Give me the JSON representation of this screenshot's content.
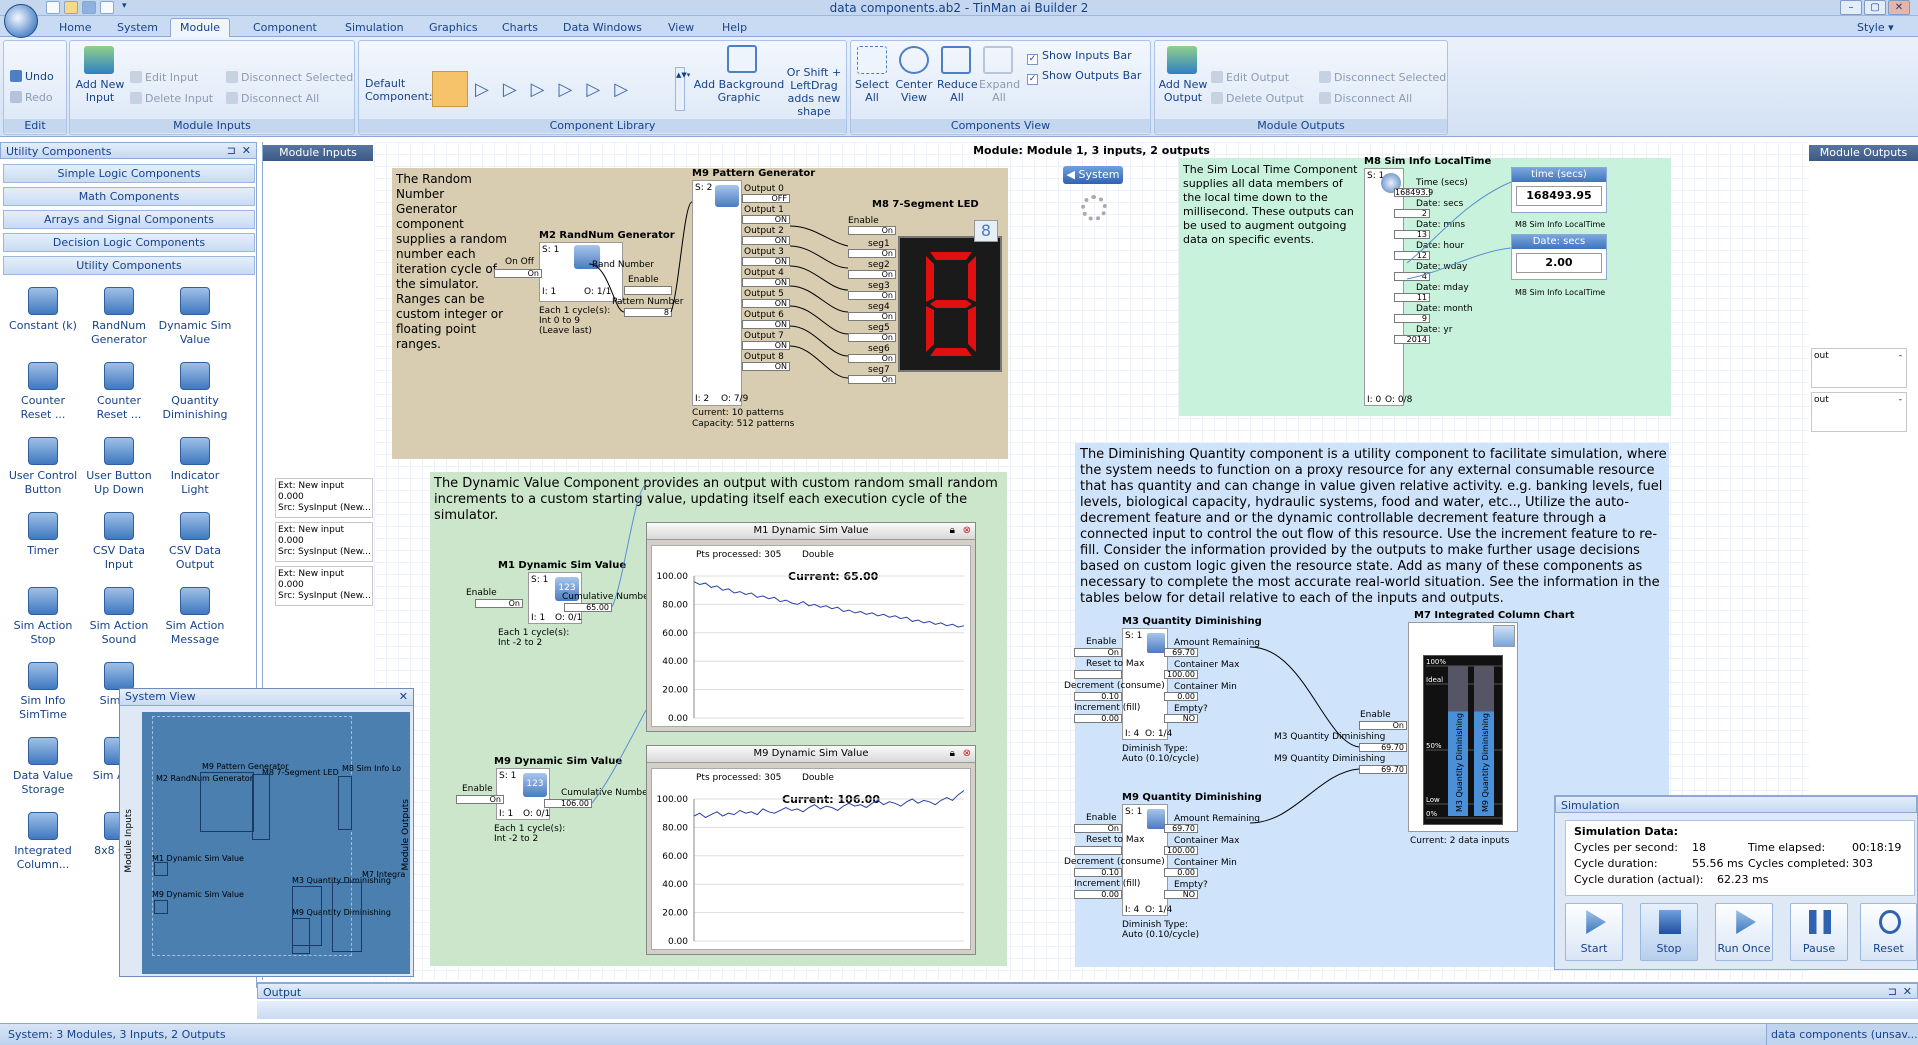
{
  "window": {
    "title": "data components.ab2 - TinMan ai Builder 2",
    "style_label": "Style"
  },
  "tabs": [
    "Home",
    "System",
    "Module",
    "Component",
    "Simulation",
    "Graphics",
    "Charts",
    "Data Windows",
    "View",
    "Help"
  ],
  "ribbon": {
    "edit": {
      "undo": "Undo",
      "redo": "Redo",
      "label": "Edit"
    },
    "module_inputs": {
      "add_new_input": "Add New Input",
      "edit_input": "Edit Input",
      "delete_input": "Delete Input",
      "disconnect_selected": "Disconnect Selected",
      "disconnect_all": "Disconnect All",
      "label": "Module Inputs"
    },
    "component_library": {
      "default_component": "Default Component:",
      "add_background": "Add Background Graphic",
      "or_shift": "Or Shift + LeftDrag adds new shape",
      "label": "Component Library"
    },
    "components_view": {
      "select_all": "Select All",
      "center_view": "Center View",
      "reduce_all": "Reduce All",
      "expand_all": "Expand All",
      "show_inputs_bar": "Show Inputs Bar",
      "show_outputs_bar": "Show Outputs Bar",
      "label": "Components View"
    },
    "module_outputs": {
      "add_new_output": "Add New Output",
      "edit_output": "Edit Output",
      "delete_output": "Delete Output",
      "disconnect_selected": "Disconnect Selected",
      "disconnect_all": "Disconnect All",
      "label": "Module Outputs"
    }
  },
  "left_panel": {
    "title": "Utility Components",
    "categories": [
      "Simple Logic Components",
      "Math Components",
      "Arrays and Signal Components",
      "Decision Logic Components",
      "Utility Components"
    ],
    "tools": [
      "Constant (k)",
      "RandNum Generator",
      "Dynamic Sim Value",
      "Counter Reset ...",
      "Counter Reset ...",
      "Quantity Diminishing",
      "User Control Button",
      "User Button Up Down",
      "Indicator Light",
      "Timer",
      "CSV Data Input",
      "CSV Data Output",
      "Sim Action Stop",
      "Sim Action Sound",
      "Sim Action Message",
      "Sim Info SimTime",
      "Sim Co",
      "",
      "Data Value Storage",
      "Sim A For",
      "",
      "Integrated Column...",
      "8x8 Cont",
      ""
    ]
  },
  "system_view": {
    "title": "System View",
    "module_inputs": "Module Inputs",
    "module_outputs": "Module Outputs",
    "labels": [
      "M9 Pattern Generator",
      "M2 RandNum Generator",
      "M8 7-Segment LED",
      "M8 Sim Info Lo",
      "M1 Dynamic Sim Value",
      "M3 Quantity Diminishing",
      "M9 Dynamic Sim Value",
      "M9 Quantity Diminishing",
      "M7 Integra"
    ]
  },
  "module_inputs": {
    "title": "Module Inputs",
    "items": [
      {
        "a": "Ext: New input",
        "b": "0.000",
        "c": "Src: SysInput (New..."
      },
      {
        "a": "Ext: New input",
        "b": "0.000",
        "c": "Src: SysInput (New..."
      },
      {
        "a": "Ext: New input",
        "b": "0.000",
        "c": "Src: SysInput (New..."
      }
    ]
  },
  "module_outputs": {
    "title": "Module Outputs",
    "items": [
      "out",
      "out"
    ]
  },
  "canvas": {
    "header": "Module: Module 1, 3 inputs, 2 outputs",
    "system_button": "System",
    "random_desc": "The Random Number Generator component supplies a random number each iteration cycle of the simulator. Ranges can be custom integer or floating point ranges.",
    "m2": {
      "title": "M2 RandNum Generator",
      "s": "S: 1",
      "onoff": "On Off",
      "on": "On",
      "rand": "Rand Number",
      "enable": "Enable",
      "pattern": "Pattern Number",
      "pval": "8",
      "io": "I: 1",
      "o": "O: 1/1",
      "each": "Each 1 cycle(s):",
      "range": "Int 0 to 9",
      "leave": "(Leave last)"
    },
    "m9p": {
      "title": "M9 Pattern Generator",
      "s": "S: 2",
      "outputs": [
        "Output 0",
        "Output 1",
        "Output 2",
        "Output 3",
        "Output 4",
        "Output 5",
        "Output 6",
        "Output 7",
        "Output 8"
      ],
      "states": [
        "OFF",
        "ON",
        "ON",
        "ON",
        "ON",
        "ON",
        "ON",
        "ON",
        "ON"
      ],
      "io": "I: 2",
      "o": "O: 7/9",
      "current": "Current: 10 patterns",
      "capacity": "Capacity: 512 patterns"
    },
    "m8led": {
      "title": "M8 7-Segment LED",
      "enable": "Enable",
      "segs": [
        "seg1",
        "seg2",
        "seg3",
        "seg4",
        "seg5",
        "seg6",
        "seg7"
      ],
      "on": "On"
    },
    "sim_local_desc": "The Sim Local Time Component supplies all data members of the local time down to the millisecond. These outputs can be used to augment outgoing data on specific events.",
    "m8sim": {
      "title": "M8 Sim Info LocalTime",
      "s": "S: 1",
      "fields": [
        {
          "n": "Time (secs)",
          "v": "168493.9"
        },
        {
          "n": "Date: secs",
          "v": "2"
        },
        {
          "n": "Date: mins",
          "v": "13"
        },
        {
          "n": "Date: hour",
          "v": "12"
        },
        {
          "n": "Date: wday",
          "v": "4"
        },
        {
          "n": "Date: mday",
          "v": "11"
        },
        {
          "n": "Date: month",
          "v": "9"
        },
        {
          "n": "Date: yr",
          "v": "2014"
        }
      ],
      "io": "I: 0",
      "o": "O: 0/8",
      "disp1_title": "time (secs)",
      "disp1_val": "168493.95",
      "disp1_sub": "M8 Sim Info LocalTime",
      "disp2_title": "Date: secs",
      "disp2_val": "2.00",
      "disp2_sub": "M8 Sim Info LocalTime"
    },
    "dyn_desc": "The Dynamic Value Component provides an output with custom random small random increments to a custom starting value, updating itself each execution cycle of the simulator.",
    "m1": {
      "title": "M1 Dynamic Sim Value",
      "s": "S: 1",
      "enable": "Enable",
      "on": "On",
      "out": "Cumulative Number",
      "val": "65.00",
      "io": "I: 1",
      "o": "O: 0/1",
      "each": "Each 1 cycle(s):",
      "range": "Int -2 to 2"
    },
    "m9d": {
      "title": "M9 Dynamic Sim Value",
      "s": "S: 1",
      "enable": "Enable",
      "on": "On",
      "out": "Cumulative Number",
      "val": "106.00",
      "io": "I: 1",
      "o": "O: 0/1",
      "each": "Each 1 cycle(s):",
      "range": "Int -2 to 2"
    },
    "chart1": {
      "title": "M1 Dynamic Sim Value",
      "pts": "Pts processed: 305",
      "type": "Double",
      "current": "Current: 65.00",
      "yticks": [
        "100.00",
        "80.00",
        "60.00",
        "40.00",
        "20.00",
        "0.00"
      ]
    },
    "chart2": {
      "title": "M9 Dynamic Sim Value",
      "pts": "Pts processed: 305",
      "type": "Double",
      "current": "Current: 106.00",
      "yticks": [
        "100.00",
        "80.00",
        "60.00",
        "40.00",
        "20.00",
        "0.00"
      ]
    },
    "dim_desc": "The Diminishing Quantity component is a utility component to facilitate simulation, where the system needs to function on a proxy resource for any external consumable resource that has quantity and can change in value given relative activity. e.g. banking levels, fuel levels, biological capacity, hydraulic systems, food and water, etc.., Utilize the auto-decrement feature and or the dynamic controllable decrement feature through a connected input to control the out flow of this resource. Use the increment feature to re-fill. Consider the information provided by the outputs to make further usage decisions based on custom logic given the resource state. Add as many of these components as necessary to complete the most accurate real-world situation. See the information in the tables below for detail relative to each of the inputs and outputs.",
    "m3": {
      "title": "M3 Quantity Diminishing",
      "s": "S: 1",
      "in": [
        "Enable",
        "Reset to Max",
        "Decrement (consume)",
        "Increment (fill)"
      ],
      "inv": [
        "On",
        "",
        "0.10",
        "0.00"
      ],
      "out": [
        "Amount Remaining",
        "Container Max",
        "Container Min",
        "Empty?"
      ],
      "outv": [
        "69.70",
        "100.00",
        "0.00",
        "NO"
      ],
      "io": "I: 4",
      "o": "O: 1/4",
      "type": "Diminish Type:",
      "auto": "Auto (0.10/cycle)"
    },
    "m9q": {
      "title": "M9 Quantity Diminishing",
      "s": "S: 1",
      "in": [
        "Enable",
        "Reset to Max",
        "Decrement (consume)",
        "Increment (fill)"
      ],
      "inv": [
        "On",
        "",
        "0.10",
        "0.00"
      ],
      "out": [
        "Amount Remaining",
        "Container Max",
        "Container Min",
        "Empty?"
      ],
      "outv": [
        "69.70",
        "100.00",
        "0.00",
        "NO"
      ],
      "io": "I: 4",
      "o": "O: 1/4",
      "type": "Diminish Type:",
      "auto": "Auto (0.10/cycle)"
    },
    "m7": {
      "title": "M7 Integrated Column Chart",
      "enable": "Enable",
      "on": "On",
      "in1": "M3 Quantity Diminishing",
      "in2": "M9 Quantity Diminishing",
      "v1": "69.70",
      "v2": "69.70",
      "current": "Current: 2 data inputs",
      "ylabels": [
        "100%",
        "Ideal",
        "50%",
        "Low",
        "0%"
      ],
      "bars": [
        "M3 Quantity Diminishing",
        "M9 Quantity Diminishing"
      ]
    }
  },
  "simulation": {
    "title": "Simulation",
    "data_label": "Simulation Data:",
    "cps_label": "Cycles per second:",
    "cps": "18",
    "elapsed_label": "Time elapsed:",
    "elapsed": "00:18:19",
    "dur_label": "Cycle duration:",
    "dur": "55.56 ms",
    "completed_label": "Cycles completed:",
    "completed": "303",
    "act_label": "Cycle duration (actual):",
    "act": "62.23 ms",
    "buttons": [
      "Start",
      "Stop",
      "Run Once",
      "Pause",
      "Reset"
    ]
  },
  "output_panel": {
    "title": "Output"
  },
  "status": {
    "left": "System: 3 Modules, 3 Inputs, 2 Outputs",
    "right": "data components (unsav..."
  },
  "chart_data": [
    {
      "type": "line",
      "title": "M1 Dynamic Sim Value",
      "ylim": [
        0,
        100
      ],
      "series": [
        {
          "values": [
            96,
            94,
            95,
            92,
            93,
            90,
            91,
            88,
            89,
            87,
            88,
            85,
            86,
            84,
            85,
            82,
            83,
            81,
            80,
            82,
            79,
            80,
            78,
            79,
            77,
            78,
            75,
            76,
            74,
            75,
            73,
            74,
            72,
            73,
            71,
            72,
            70,
            71,
            68,
            69,
            67,
            68,
            66,
            67,
            65,
            66,
            64,
            65
          ]
        }
      ]
    },
    {
      "type": "line",
      "title": "M9 Dynamic Sim Value",
      "ylim": [
        0,
        100
      ],
      "series": [
        {
          "values": [
            88,
            90,
            87,
            89,
            91,
            88,
            90,
            89,
            92,
            90,
            91,
            89,
            93,
            91,
            90,
            92,
            94,
            92,
            93,
            91,
            94,
            96,
            93,
            95,
            94,
            92,
            95,
            97,
            95,
            96,
            94,
            97,
            99,
            96,
            98,
            97,
            95,
            98,
            100,
            97,
            99,
            98,
            96,
            99,
            101,
            99,
            103,
            106
          ]
        }
      ]
    }
  ]
}
